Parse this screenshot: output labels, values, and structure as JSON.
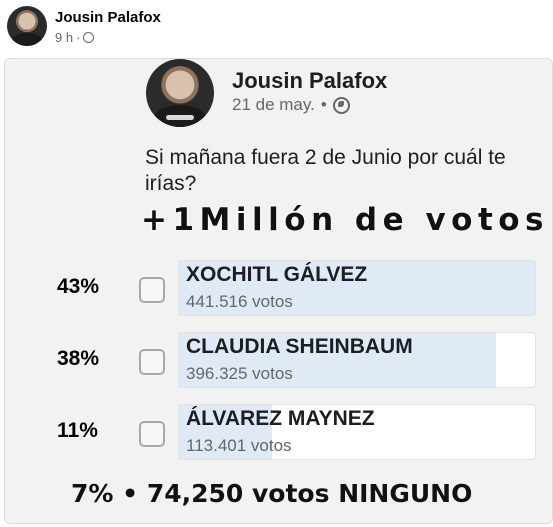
{
  "post": {
    "author": "Jousin Palafox",
    "time": "9 h",
    "separator": "·"
  },
  "card": {
    "author": "Jousin Palafox",
    "date": "21 de may.",
    "separator": "•",
    "question": "Si mañana fuera 2 de Junio por cuál te irías?",
    "headline": "+1Millón de votos",
    "options": [
      {
        "percent_label": "43%",
        "name": "XOCHITL GÁLVEZ",
        "votes": "441.516 votos",
        "fill": 1.0
      },
      {
        "percent_label": "38%",
        "name": "CLAUDIA SHEINBAUM",
        "votes": "396.325 votos",
        "fill": 0.89
      },
      {
        "percent_label": "11%",
        "name": "ÁLVAREZ MAYNEZ",
        "votes": "113.401 votos",
        "fill": 0.26
      }
    ],
    "footer": "7% • 74,250 votos NINGUNO"
  },
  "colors": {
    "bar_fill": "#e0e9f6",
    "card_bg": "#f2f2f2",
    "meta_text": "#65676b"
  },
  "icons": {
    "privacy": "globe-icon"
  }
}
